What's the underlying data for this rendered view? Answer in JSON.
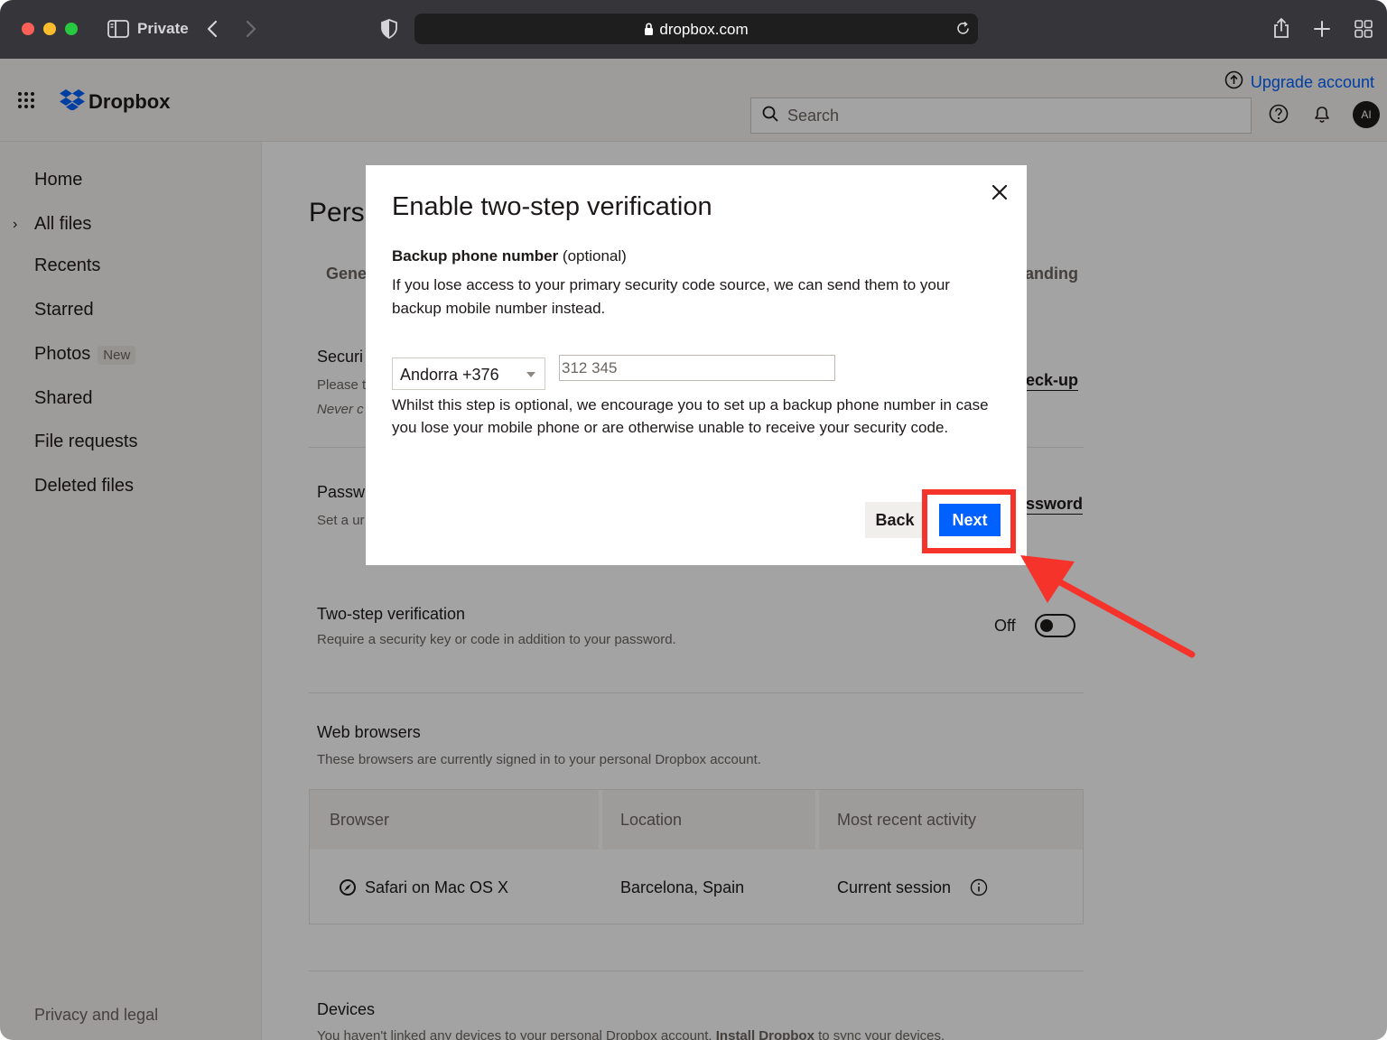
{
  "browser": {
    "private_label": "Private",
    "url": "dropbox.com"
  },
  "header": {
    "logo_text": "Dropbox",
    "upgrade_label": "Upgrade account",
    "search_placeholder": "Search",
    "avatar_initials": "AI"
  },
  "sidebar": {
    "items": [
      {
        "label": "Home"
      },
      {
        "label": "All files"
      },
      {
        "label": "Recents"
      },
      {
        "label": "Starred"
      },
      {
        "label": "Photos",
        "badge": "New"
      },
      {
        "label": "Shared"
      },
      {
        "label": "File requests"
      },
      {
        "label": "Deleted files"
      }
    ],
    "footer": "Privacy and legal"
  },
  "main": {
    "title_partial": "Pers",
    "tab_left_partial": "Gene",
    "tab_right_partial": "anding",
    "security": {
      "title_partial": "Securi",
      "desc1_partial": "Please t",
      "desc2_partial": "Never c",
      "link_partial": "eck-up"
    },
    "password": {
      "title_partial": "Passw",
      "desc_partial": "Set a ur",
      "link_partial": "ssword"
    },
    "two_step": {
      "title": "Two-step verification",
      "desc": "Require a security key or code in addition to your password.",
      "toggle_label": "Off"
    },
    "web_browsers": {
      "title": "Web browsers",
      "desc": "These browsers are currently signed in to your personal Dropbox account.",
      "columns": [
        "Browser",
        "Location",
        "Most recent activity"
      ],
      "rows": [
        {
          "browser": "Safari on Mac OS X",
          "location": "Barcelona, Spain",
          "activity": "Current session"
        }
      ]
    },
    "devices": {
      "title": "Devices",
      "desc_partial": "You haven't linked any devices to your personal Dropbox account.",
      "desc_link": "Install Dropbox",
      "desc_tail": "to sync your devices."
    }
  },
  "modal": {
    "title": "Enable two-step verification",
    "backup_label": "Backup phone number",
    "backup_optional": "(optional)",
    "intro": "If you lose access to your primary security code source, we can send them to your backup mobile number instead.",
    "country": "Andorra +376",
    "phone_value": "312 345",
    "note": "Whilst this step is optional, we encourage you to set up a backup phone number in case you lose your mobile phone or are otherwise unable to receive your security code.",
    "back_label": "Back",
    "next_label": "Next"
  },
  "colors": {
    "accent": "#0061fe",
    "highlight": "#f5332a"
  }
}
